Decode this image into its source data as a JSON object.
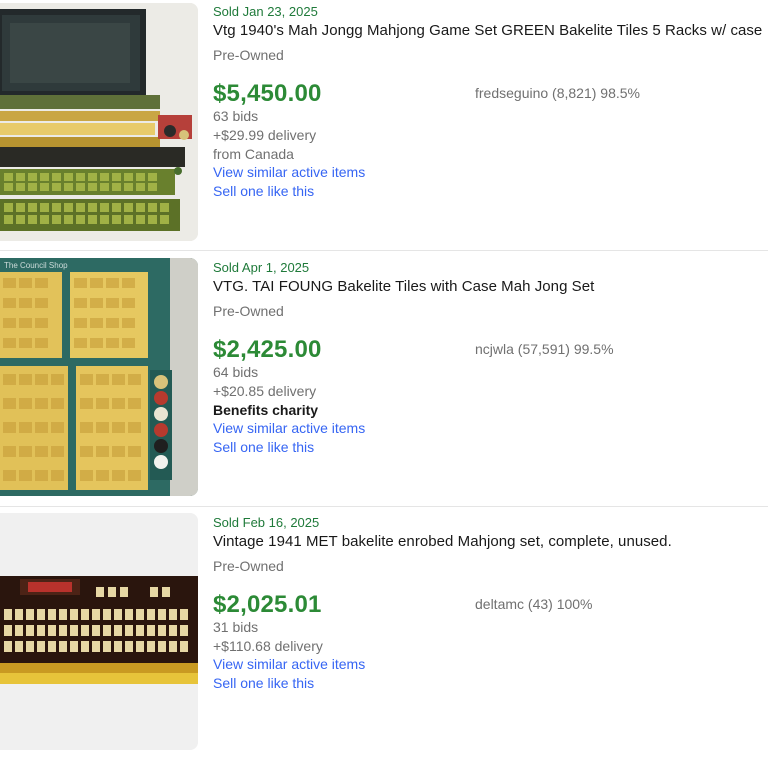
{
  "listings": [
    {
      "sold_date": "Sold Jan 23, 2025",
      "title": "Vtg 1940's Mah Jongg Mahjong Game Set GREEN Bakelite Tiles 5 Racks w/ case",
      "condition": "Pre-Owned",
      "price": "$5,450.00",
      "seller": "fredseguino (8,821) 98.5%",
      "bids": "63 bids",
      "delivery": "+$29.99 delivery",
      "location": "from Canada",
      "view_similar": "View similar active items",
      "sell_one": "Sell one like this"
    },
    {
      "sold_date": "Sold Apr 1, 2025",
      "title": "VTG. TAI FOUNG Bakelite Tiles with Case Mah Jong Set",
      "condition": "Pre-Owned",
      "price": "$2,425.00",
      "seller": "ncjwla (57,591) 99.5%",
      "bids": "64 bids",
      "delivery": "+$20.85 delivery",
      "charity": "Benefits charity",
      "view_similar": "View similar active items",
      "sell_one": "Sell one like this",
      "image_watermark": "The Council Shop"
    },
    {
      "sold_date": "Sold Feb 16, 2025",
      "title": "Vintage 1941 MET bakelite enrobed Mahjong set, complete, unused.",
      "condition": "Pre-Owned",
      "price": "$2,025.01",
      "seller": "deltamc (43) 100%",
      "bids": "31 bids",
      "delivery": "+$110.68 delivery",
      "view_similar": "View similar active items",
      "sell_one": "Sell one like this"
    }
  ]
}
